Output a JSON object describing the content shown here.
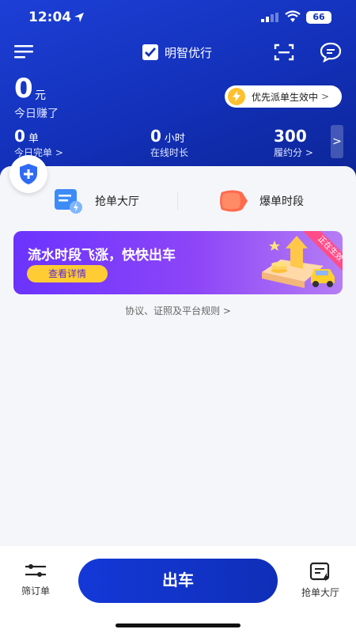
{
  "status_bar": {
    "time": "12:04",
    "battery": "66"
  },
  "nav": {
    "brand": "明智优行"
  },
  "earnings": {
    "amount": "0",
    "unit": "元",
    "label": "今日赚了"
  },
  "priority": {
    "label": "优先派单生效中",
    "chevron": ">"
  },
  "stats": [
    {
      "value": "0",
      "unit": "单",
      "label": "今日完单 >"
    },
    {
      "value": "0",
      "unit": "小时",
      "label": "在线时长"
    },
    {
      "value": "300",
      "unit": "",
      "label": "履约分 >"
    }
  ],
  "stats_next": ">",
  "entries": [
    {
      "label": "抢单大厅",
      "icon": "order-hall-icon"
    },
    {
      "label": "爆单时段",
      "icon": "surge-icon",
      "badge": "爆"
    }
  ],
  "banner": {
    "title": "流水时段飞涨，快快出车",
    "button": "查看详情",
    "ribbon": "正在生效"
  },
  "rules_link": "协议、证照及平台规则 >",
  "bottom": {
    "left_tab": "筛订单",
    "main_button": "出车",
    "right_tab": "抢单大厅"
  },
  "colors": {
    "primary": "#1230b8",
    "accent": "#ffcc33",
    "banner": "#7a3cf8"
  }
}
